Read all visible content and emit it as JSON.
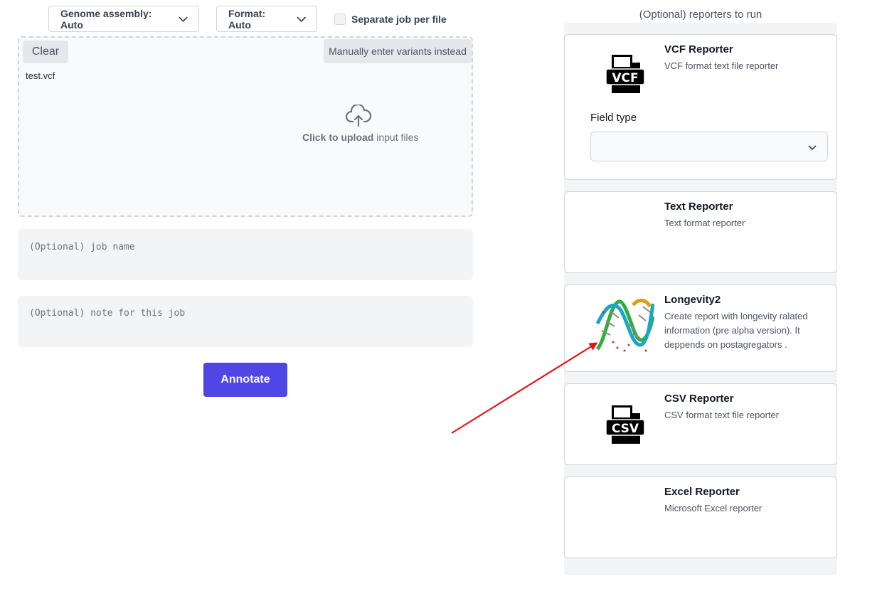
{
  "controls": {
    "genome_label": "Genome assembly: Auto",
    "format_label": "Format: Auto",
    "separate_label": "Separate job per file"
  },
  "upload": {
    "clear_label": "Clear",
    "manual_label": "Manually enter variants instead",
    "file_name": "test.vcf",
    "upload_bold": "Click to upload",
    "upload_rest": " input files"
  },
  "job": {
    "name_placeholder": "(Optional) job name",
    "note_placeholder": "(Optional) note for this job",
    "annotate_label": "Annotate"
  },
  "reporters": {
    "heading": "(Optional) reporters to run",
    "field_type_label": "Field type",
    "items": [
      {
        "title": "VCF Reporter",
        "desc": "VCF format text file reporter",
        "icon_text": "VCF"
      },
      {
        "title": "Text Reporter",
        "desc": "Text format reporter"
      },
      {
        "title": "Longevity2",
        "desc": "Create report with longevity ralated information (pre alpha version). It deppends on postagregators ."
      },
      {
        "title": "CSV Reporter",
        "desc": "CSV format text file reporter",
        "icon_text": "CSV"
      },
      {
        "title": "Excel Reporter",
        "desc": "Microsoft Excel reporter"
      }
    ]
  },
  "colors": {
    "accent": "#4f46e5",
    "arrow": "#e8141c"
  }
}
